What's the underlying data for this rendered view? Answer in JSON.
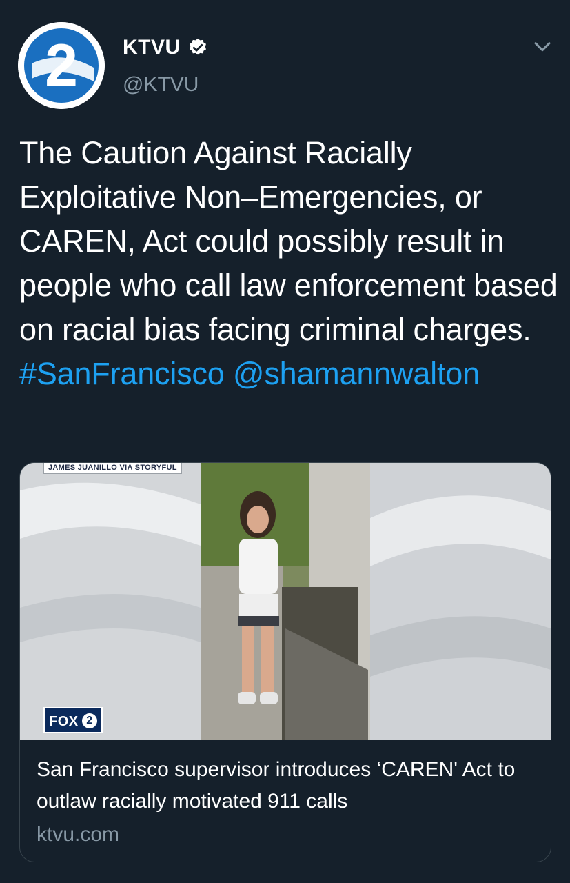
{
  "author": {
    "display_name": "KTVU",
    "handle": "@KTVU",
    "verified": true,
    "avatar_icon": "ktvu-2-logo-icon",
    "avatar_digit": "2"
  },
  "tweet": {
    "text": "The Caution Against Racially Exploitative Non–Emergencies, or CAREN, Act could possibly result in people who call law enforcement based on racial bias facing criminal charges.",
    "hashtag": "#SanFrancisco",
    "mention": "@shamannwalton"
  },
  "card": {
    "image_credit": "JAMES JUANILLO VIA STORYFUL",
    "station_logo": "FOX",
    "station_logo_digit": "2",
    "title": "San Francisco supervisor introduces ‘CAREN' Act to outlaw racially motivated 911 calls",
    "domain": "ktvu.com"
  },
  "colors": {
    "background": "#15202b",
    "link": "#1da1f2",
    "secondary_text": "#8899a6",
    "verified_badge": "#ffffff"
  },
  "icons": {
    "menu": "chevron-down-icon",
    "verified": "verified-badge-icon"
  }
}
